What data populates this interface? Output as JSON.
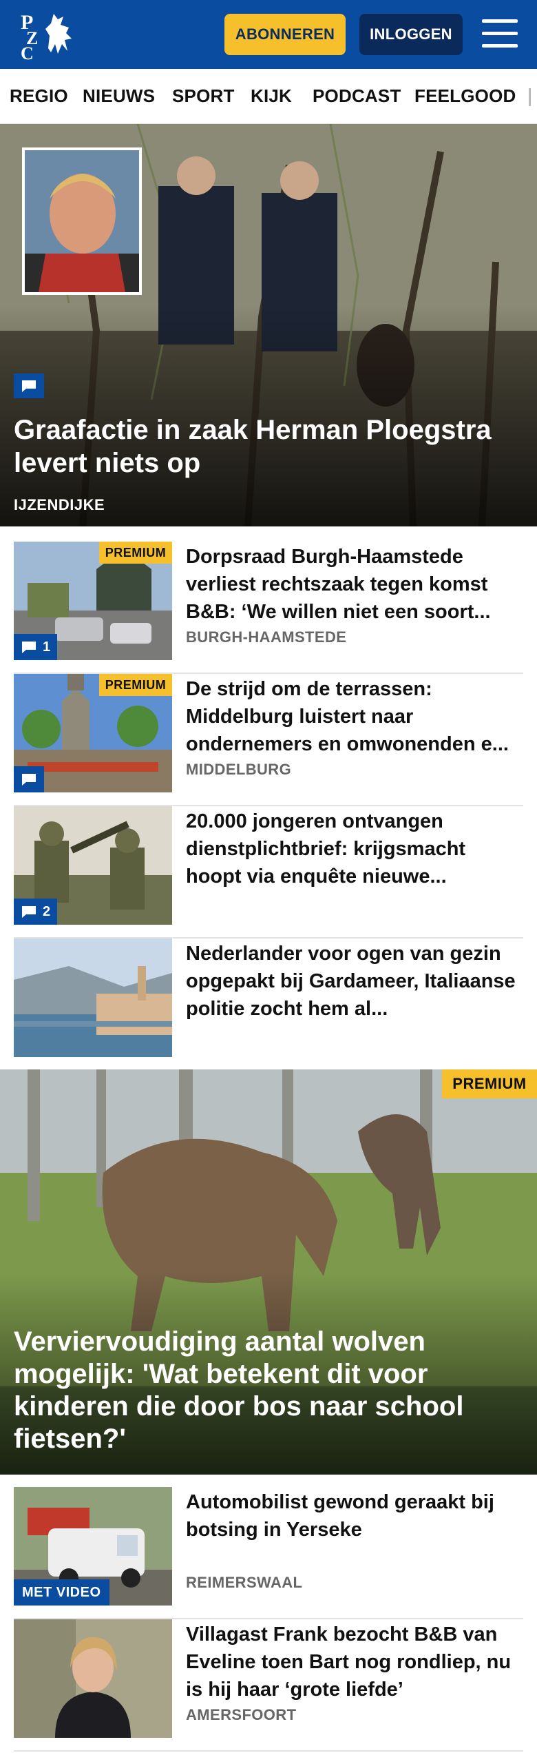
{
  "header": {
    "logo_text": "PZC",
    "subscribe_label": "ABONNEREN",
    "login_label": "INLOGGEN"
  },
  "nav": {
    "items": [
      "REGIO",
      "NIEUWS",
      "SPORT",
      "KIJK",
      "PODCAST",
      "FEELGOOD"
    ]
  },
  "hero": {
    "title": "Graafactie in zaak Herman Ploegstra levert niets op",
    "location": "IJZENDIJKE",
    "icon": "comment-icon"
  },
  "articles": [
    {
      "title": "Dorpsraad Burgh-Haamstede verliest rechtszaak tegen komst B&B: ‘We willen niet een soort...",
      "location": "BURGH-HAAMSTEDE",
      "premium": "PREMIUM",
      "comments": "1"
    },
    {
      "title": "De strijd om de terrassen: Middelburg luistert naar ondernemers en omwonenden e...",
      "location": "MIDDELBURG",
      "premium": "PREMIUM",
      "comments": ""
    },
    {
      "title": "20.000 jongeren ontvangen dienstplichtbrief: krijgsmacht hoopt via enquête nieuwe...",
      "location": "",
      "premium": "",
      "comments": "2"
    },
    {
      "title": "Nederlander voor ogen van gezin opgepakt bij Gardameer, Italiaanse politie zocht hem al...",
      "location": "",
      "premium": "",
      "comments": ""
    }
  ],
  "feature": {
    "premium": "PREMIUM",
    "title": "Verviervoudiging aantal wolven mogelijk: 'Wat betekent dit voor kinderen die door bos naar school fietsen?'"
  },
  "articles_more": [
    {
      "title": "Automobilist gewond geraakt bij botsing in Yerseke",
      "location": "REIMERSWAAL",
      "badge": "MET VIDEO"
    },
    {
      "title": "Villagast Frank bezocht B&B van Eveline toen Bart nog rondliep, nu is hij haar ‘grote liefde’",
      "location": "AMERSFOORT",
      "badge": ""
    }
  ],
  "colors": {
    "brand_blue": "#0a4da0",
    "premium_yellow": "#f6c02c",
    "login_navy": "#0b2a5c"
  }
}
